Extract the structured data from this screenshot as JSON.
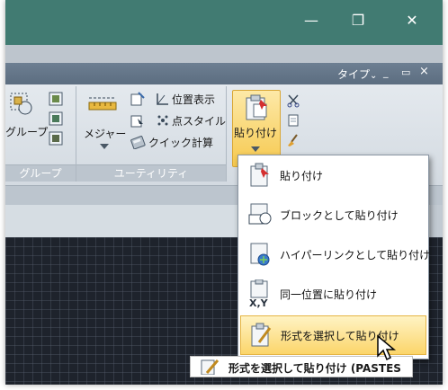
{
  "window_controls": {
    "minimize": "—",
    "restore": "❐",
    "close": "✕"
  },
  "menubar": {
    "type_label": "タイプ",
    "type_chevron": "⌄",
    "min_label": "_",
    "restore_label": "▭",
    "close_label": "×"
  },
  "ribbon": {
    "group_panel": {
      "button_label": "グループ",
      "title": "グループ"
    },
    "utility_panel": {
      "measure_label": "メジャー",
      "id_point_label": "位置表示",
      "point_style_label": "点スタイル",
      "quick_calc_label": "クイック計算",
      "title": "ユーティリティ"
    },
    "clipboard_panel": {
      "paste_label": "貼り付け"
    }
  },
  "paste_menu": {
    "items": [
      {
        "label": "貼り付け",
        "icon": "paste-icon"
      },
      {
        "label": "ブロックとして貼り付け",
        "icon": "paste-as-block-icon"
      },
      {
        "label": "ハイパーリンクとして貼り付け",
        "icon": "paste-as-hyperlink-icon"
      },
      {
        "label": "同一位置に貼り付け",
        "icon": "paste-to-original-coordinates-icon"
      },
      {
        "label": "形式を選択して貼り付け",
        "icon": "paste-special-icon",
        "highlighted": true
      }
    ],
    "icon_text_xy": "X,Y"
  },
  "tooltip": {
    "label": "形式を選択して貼り付け (PASTES"
  },
  "colors": {
    "titlebar": "#417b72",
    "highlight": "#fbd56a",
    "canvas": "#1e232c"
  }
}
